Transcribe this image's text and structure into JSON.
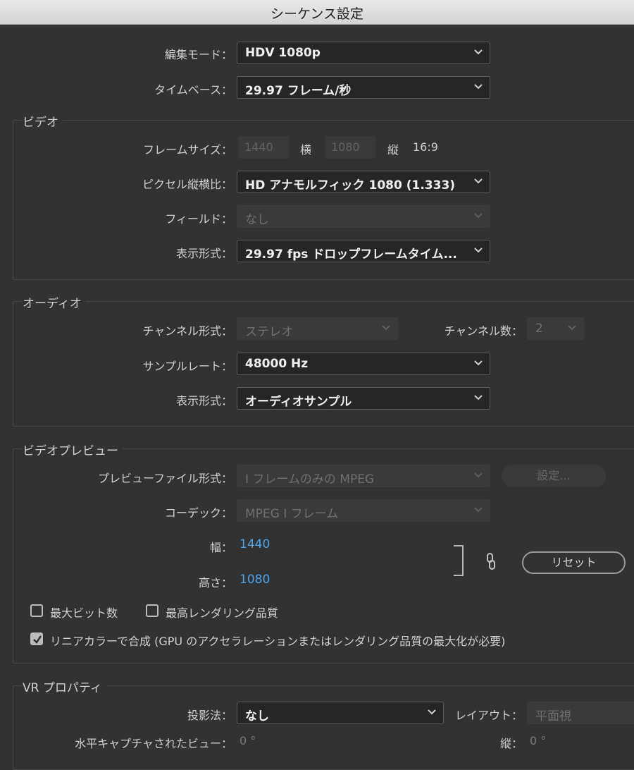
{
  "window": {
    "title": "シーケンス設定"
  },
  "general": {
    "edit_mode": {
      "label": "編集モード：",
      "value": "HDV 1080p"
    },
    "timebase": {
      "label": "タイムベース：",
      "value": "29.97  フレーム/秒"
    }
  },
  "video": {
    "title": "ビデオ",
    "frame_size": {
      "label": "フレームサイズ：",
      "width": "1440",
      "width_label": "横",
      "height": "1080",
      "height_label": "縦",
      "ratio": "16:9"
    },
    "pixel_aspect": {
      "label": "ピクセル縦横比：",
      "value": "HD アナモルフィック 1080 (1.333)"
    },
    "fields": {
      "label": "フィールド：",
      "value": "なし"
    },
    "display_format": {
      "label": "表示形式：",
      "value": "29.97 fps ドロップフレームタイム..."
    }
  },
  "audio": {
    "title": "オーディオ",
    "channel_format": {
      "label": "チャンネル形式：",
      "value": "ステレオ"
    },
    "channel_count": {
      "label": "チャンネル数：",
      "value": "2"
    },
    "sample_rate": {
      "label": "サンプルレート：",
      "value": "48000 Hz"
    },
    "display_format": {
      "label": "表示形式：",
      "value": "オーディオサンプル"
    }
  },
  "preview": {
    "title": "ビデオプレビュー",
    "file_format": {
      "label": "プレビューファイル形式：",
      "value": "I フレームのみの MPEG"
    },
    "settings_button": "設定...",
    "codec": {
      "label": "コーデック：",
      "value": "MPEG I フレーム"
    },
    "width": {
      "label": "幅：",
      "value": "1440"
    },
    "height": {
      "label": "高さ：",
      "value": "1080"
    },
    "reset_button": "リセット",
    "max_bit_depth": {
      "label": "最大ビット数",
      "checked": false
    },
    "max_render_quality": {
      "label": "最高レンダリング品質",
      "checked": false
    },
    "linear_color": {
      "label": "リニアカラーで合成 (GPU のアクセラレーションまたはレンダリング品質の最大化が必要)",
      "checked": true
    }
  },
  "vr": {
    "title": "VR プロパティ",
    "projection": {
      "label": "投影法：",
      "value": "なし"
    },
    "layout": {
      "label": "レイアウト：",
      "value": "平面視"
    },
    "horizontal": {
      "label": "水平キャプチャされたビュー：",
      "value": "0 °"
    },
    "vertical": {
      "label": "縦：",
      "value": "0 °"
    }
  }
}
